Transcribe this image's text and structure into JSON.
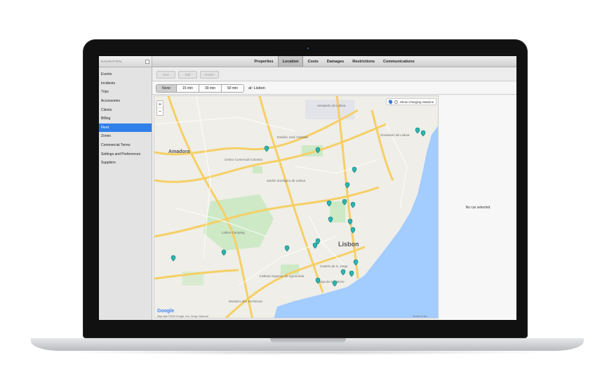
{
  "sidebar": {
    "title": "NAVIGATION",
    "collapse": "‹",
    "items": [
      {
        "label": "Events"
      },
      {
        "label": "Incidents"
      },
      {
        "label": "Trips"
      },
      {
        "label": "Accessories"
      },
      {
        "label": "Clients"
      },
      {
        "label": "Billing"
      },
      {
        "label": "Fleet",
        "active": true
      },
      {
        "label": "Zones"
      },
      {
        "label": "Commercial Terms"
      },
      {
        "label": "Settings and Preferences"
      },
      {
        "label": "Suppliers"
      }
    ]
  },
  "tabs": [
    {
      "label": "Properties"
    },
    {
      "label": "Location",
      "active": true
    },
    {
      "label": "Costs"
    },
    {
      "label": "Damages"
    },
    {
      "label": "Restrictions"
    },
    {
      "label": "Communications"
    }
  ],
  "toolbar": {
    "new_label": "New",
    "edit_label": "Edit",
    "delete_label": "Delete"
  },
  "filter": {
    "intervals": [
      {
        "label": "None",
        "active": true
      },
      {
        "label": "15 min"
      },
      {
        "label": "30 min"
      },
      {
        "label": "60 min"
      }
    ],
    "location_label": "at: Lisbon"
  },
  "map": {
    "zoom_in": "+",
    "zoom_out": "−",
    "charging_label": "Show Charging Stations",
    "labels": {
      "amadora": "Amadora",
      "lisbon": "Lisbon",
      "aeroporto": "Aeroporto de Lisboa",
      "estadio": "Estádio José Alvalade",
      "zoologico": "Jardim Zoológico de Lisboa",
      "colombo": "Centro Comercial Colombo",
      "oceanario": "Oceanário de Lisboa",
      "castelo": "Castelo de S. Jorge",
      "comercio": "Praça do Comércio",
      "instituto": "Instituto Superior de Agronomia",
      "jeronimos": "Mosteiro dos Jerónimos",
      "monsanto": "Lisbon Camping",
      "google": "Google",
      "attribution": "Map data ©2016 Google, Inst. Geogr. Nacional",
      "terms": "Terms of Use"
    }
  },
  "detail": {
    "empty_text": "No car selected"
  },
  "colors": {
    "accent": "#2f80e8",
    "water": "#a3ccff",
    "pin": "#2ab5b0",
    "road": "#f6cf65",
    "park": "#c5e8c5"
  }
}
